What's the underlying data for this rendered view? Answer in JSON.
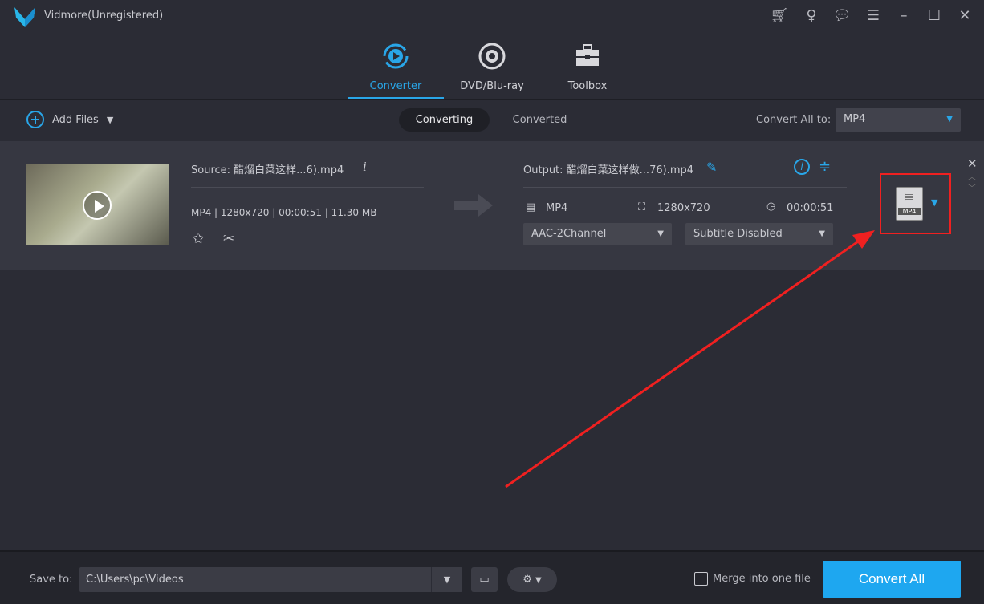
{
  "app": {
    "title": "Vidmore(Unregistered)"
  },
  "window_buttons": [
    "cart-icon",
    "key-icon",
    "feedback-icon",
    "menu-icon",
    "minimize-icon",
    "maximize-icon",
    "close-icon"
  ],
  "tabs": [
    {
      "label": "Converter",
      "active": true
    },
    {
      "label": "DVD/Blu-ray"
    },
    {
      "label": "Toolbox"
    }
  ],
  "toolbar": {
    "add_files": "Add Files",
    "converting": "Converting",
    "converted": "Converted",
    "convert_all_to_label": "Convert All to:",
    "convert_all_to_value": "MP4"
  },
  "item": {
    "source": "Source: 醋熘白菜这样...6).mp4",
    "meta": "MP4 | 1280x720 | 00:00:51 | 11.30 MB",
    "output": "Output: 醋熘白菜这样做...76).mp4",
    "out_format": "MP4",
    "out_resolution": "1280x720",
    "out_duration": "00:00:51",
    "audio": "AAC-2Channel",
    "subtitle": "Subtitle Disabled",
    "format_badge": "MP4"
  },
  "bottom": {
    "save_to_label": "Save to:",
    "save_path": "C:\\Users\\pc\\Videos",
    "merge_label": "Merge into one file",
    "convert_all": "Convert All"
  },
  "colors": {
    "accent": "#1ea7f0",
    "highlight": "#f02020",
    "background": "#2b2c35"
  }
}
